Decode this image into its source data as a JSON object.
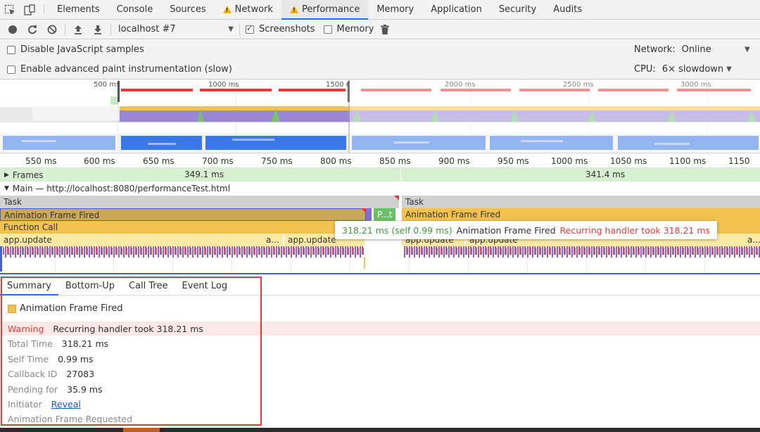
{
  "tabs": [
    {
      "label": "Elements"
    },
    {
      "label": "Console"
    },
    {
      "label": "Sources"
    },
    {
      "label": "Network",
      "warning": true
    },
    {
      "label": "Performance",
      "warning": true,
      "active": true
    },
    {
      "label": "Memory"
    },
    {
      "label": "Application"
    },
    {
      "label": "Security"
    },
    {
      "label": "Audits"
    }
  ],
  "toolbar": {
    "profile_select": "localhost #7",
    "screenshots_label": "Screenshots",
    "screenshots_checked": true,
    "memory_label": "Memory",
    "memory_checked": false
  },
  "settings": {
    "disable_js_samples": "Disable JavaScript samples",
    "advanced_paint": "Enable advanced paint instrumentation (slow)",
    "network_label": "Network:",
    "network_value": "Online",
    "cpu_label": "CPU:",
    "cpu_value": "6× slowdown"
  },
  "overview": {
    "ticks": [
      "500 ms",
      "1000 ms",
      "1500 r",
      "2000 ms",
      "2500 ms",
      "3000 ms"
    ]
  },
  "ruler": {
    "ticks": [
      "550 ms",
      "600 ms",
      "650 ms",
      "700 ms",
      "750 ms",
      "800 ms",
      "850 ms",
      "900 ms",
      "950 ms",
      "1000 ms",
      "1050 ms",
      "1100 ms",
      "1150 ms"
    ]
  },
  "frames": {
    "label": "Frames",
    "frame1": "349.1 ms",
    "frame2": "341.4 ms"
  },
  "main": {
    "title": "Main — http://localhost:8080/performanceTest.html",
    "task1": "Task",
    "task2": "Task",
    "anim1": "Animation Frame Fired",
    "anim2": "Animation Frame Fired",
    "small_green": "P...t",
    "function_call": "Function Call",
    "app_update_1": "app.update",
    "app_update_1_tail": "a...",
    "app_update_2": "app.update",
    "app_update_3": "app.update",
    "app_update_4": "app.update",
    "app_update_4_tail": "a...e"
  },
  "tooltip": {
    "duration": "318.21 ms (self 0.99 ms)",
    "name": "Animation Frame Fired",
    "warning": "Recurring handler took 318.21 ms"
  },
  "bottom_tabs": [
    {
      "label": "Summary",
      "active": true
    },
    {
      "label": "Bottom-Up"
    },
    {
      "label": "Call Tree"
    },
    {
      "label": "Event Log"
    }
  ],
  "summary": {
    "title": "Animation Frame Fired",
    "warning_label": "Warning",
    "warning_text": "Recurring handler took 318.21 ms",
    "total_time_label": "Total Time",
    "total_time": "318.21 ms",
    "self_time_label": "Self Time",
    "self_time": "0.99 ms",
    "callback_id_label": "Callback ID",
    "callback_id": "27083",
    "pending_label": "Pending for",
    "pending": "35.9 ms",
    "initiator_label": "Initiator",
    "initiator_link": "Reveal",
    "requested_label": "Animation Frame Requested"
  },
  "colors": {
    "accent": "#1a73e8",
    "warning_red": "#e53935",
    "task_gray": "#d0d0d0",
    "animation_yellow": "#f2c14e",
    "function_yellow": "#f4cf6b",
    "update_yellow": "#fbe9a6",
    "frames_green": "#d7f0d1"
  }
}
